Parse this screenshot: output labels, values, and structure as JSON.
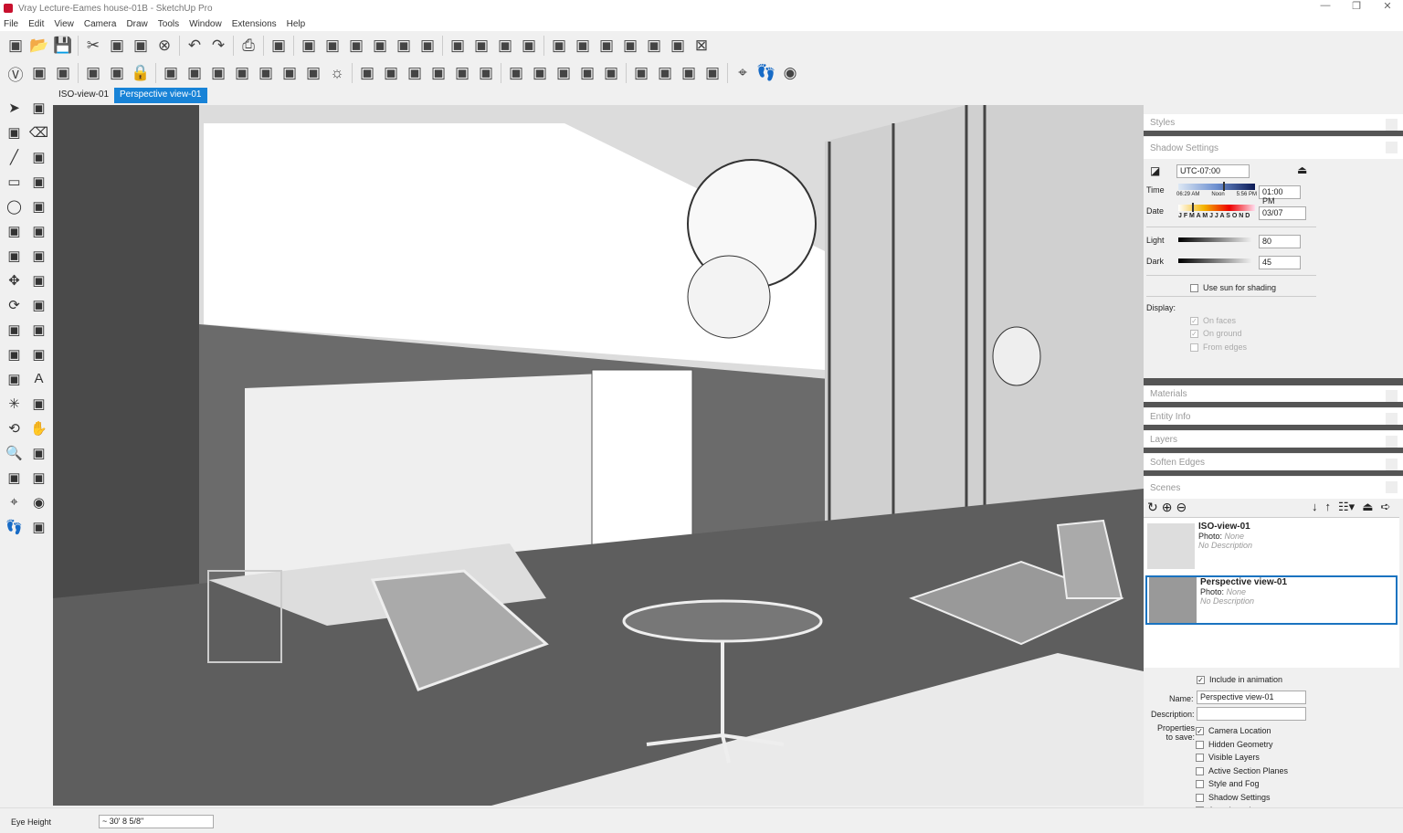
{
  "window": {
    "title": "Vray Lecture-Eames house-01B - SketchUp Pro",
    "controls": [
      "—",
      "❐",
      "✕"
    ]
  },
  "menu": [
    "File",
    "Edit",
    "View",
    "Camera",
    "Draw",
    "Tools",
    "Window",
    "Extensions",
    "Help"
  ],
  "toolbar1": [
    "new-icon",
    "open-icon",
    "save-icon",
    "|",
    "cut-icon",
    "copy-icon",
    "paste-icon",
    "erase-icon",
    "|",
    "undo-icon",
    "redo-icon",
    "|",
    "print-icon",
    "|",
    "model-info-icon",
    "|",
    "iso-view-icon",
    "top-view-icon",
    "front-view-icon",
    "right-view-icon",
    "back-view-icon",
    "left-view-icon",
    "|",
    "add-location-icon",
    "toggle-terrain-icon",
    "photo-texture-icon",
    "preview-location-icon",
    "|",
    "warehouse-icon",
    "share-model-icon",
    "components-icon",
    "extension-warehouse-icon",
    "send-layout-icon",
    "export-icon",
    "close-icon"
  ],
  "toolbar2": [
    "vray-icon",
    "teapot-render-icon",
    "interactive-render-icon",
    "|",
    "frame-buffer-icon",
    "frame-buffer2-icon",
    "lock-icon",
    "|",
    "cap-light-icon",
    "sphere-light-icon",
    "spot-light-icon",
    "ies-light-icon",
    "omni-light-icon",
    "dome-light-icon",
    "mesh-light-icon",
    "sun-icon",
    "|",
    "xray-icon",
    "wireframe-icon",
    "hidden-line-icon",
    "shaded-icon",
    "shaded-texture-icon",
    "monochrome-icon",
    "|",
    "section-plane-icon",
    "section-cut-icon",
    "display-section-icon",
    "fur-icon",
    "proxy-icon",
    "|",
    "material-1-icon",
    "material-2-icon",
    "material-3-icon",
    "material-4-icon",
    "|",
    "position-camera-icon",
    "walk-icon",
    "look-around-icon"
  ],
  "scene_tabs": [
    {
      "label": "ISO-view-01"
    },
    {
      "label": "Perspective view-01",
      "active": true
    }
  ],
  "left_tools": [
    "select-icon",
    "component-icon",
    "paint-bucket-icon",
    "eraser-icon",
    "line-icon",
    "freehand-icon",
    "rectangle-icon",
    "rotated-rectangle-icon",
    "circle-icon",
    "polygon-icon",
    "arc-icon",
    "pie-icon",
    "two-point-arc-icon",
    "three-point-arc-icon",
    "move-icon",
    "push-pull-icon",
    "rotate-icon",
    "follow-me-icon",
    "scale-icon",
    "offset-icon",
    "tape-measure-icon",
    "dimension-icon",
    "protractor-icon",
    "text-icon",
    "axes-icon",
    "3d-text-icon",
    "orbit-icon",
    "pan-icon",
    "zoom-icon",
    "zoom-window-icon",
    "zoom-extents-icon",
    "previous-view-icon",
    "position-camera-icon",
    "look-around-icon",
    "walk-icon",
    "section-plane-icon"
  ],
  "panels": {
    "styles": "Styles",
    "shadow": {
      "title": "Shadow Settings",
      "timezone": "UTC-07:00",
      "time_label": "Time",
      "time_scale": [
        "06:29 AM",
        "Noon",
        "5:56 PM"
      ],
      "time_value": "01:00 PM",
      "time_fraction": 0.58,
      "date_label": "Date",
      "months": "J F M A M J J A S O N D",
      "date_value": "03/07",
      "date_fraction": 0.18,
      "light_label": "Light",
      "light_value": "80",
      "dark_label": "Dark",
      "dark_value": "45",
      "use_sun": "Use sun for shading",
      "display_label": "Display:",
      "on_faces": "On faces",
      "on_ground": "On ground",
      "from_edges": "From edges"
    },
    "materials": "Materials",
    "entity_info": "Entity Info",
    "layers": "Layers",
    "soften_edges": "Soften Edges",
    "scenes": {
      "title": "Scenes",
      "list": [
        {
          "name": "ISO-view-01",
          "photo_label": "Photo:",
          "photo": "None",
          "description": "No Description"
        },
        {
          "name": "Perspective view-01",
          "photo_label": "Photo:",
          "photo": "None",
          "description": "No Description",
          "selected": true
        }
      ],
      "include_animation": "Include in animation",
      "name_label": "Name:",
      "name_value": "Perspective view-01",
      "description_label": "Description:",
      "description_value": "",
      "properties_label": "Properties to save:",
      "properties": [
        {
          "label": "Camera Location",
          "checked": true
        },
        {
          "label": "Hidden Geometry",
          "checked": false
        },
        {
          "label": "Visible Layers",
          "checked": false
        },
        {
          "label": "Active Section Planes",
          "checked": false
        },
        {
          "label": "Style and Fog",
          "checked": false
        },
        {
          "label": "Shadow Settings",
          "checked": false
        },
        {
          "label": "Axes Location",
          "checked": false
        }
      ]
    }
  },
  "status": {
    "label": "Eye Height",
    "value": "~ 30' 8 5/8\""
  }
}
